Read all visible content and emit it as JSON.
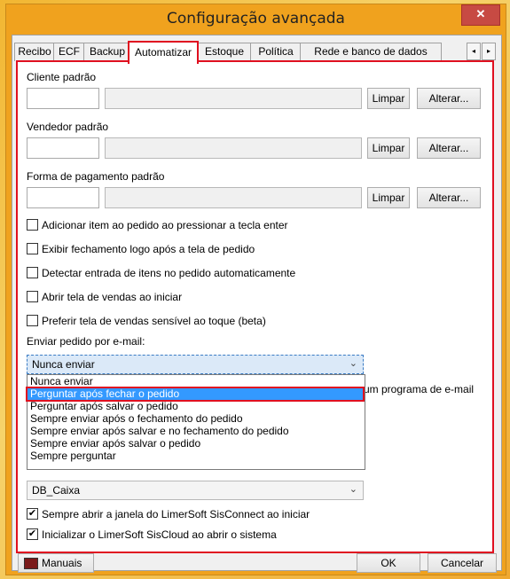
{
  "window": {
    "title": "Configuração avançada",
    "close_label": "✕"
  },
  "tabs": [
    "Recibo",
    "ECF",
    "Backup",
    "Automatizar",
    "Estoque",
    "Política",
    "Rede e banco de dados"
  ],
  "tab_scroll": {
    "left": "◂",
    "right": "▸"
  },
  "fields": {
    "cliente": {
      "label": "Cliente padrão",
      "code": "",
      "name": "",
      "limpar": "Limpar",
      "alterar": "Alterar..."
    },
    "vendedor": {
      "label": "Vendedor padrão",
      "code": "",
      "name": "",
      "limpar": "Limpar",
      "alterar": "Alterar..."
    },
    "pagamento": {
      "label": "Forma de pagamento padrão",
      "code": "",
      "name": "",
      "limpar": "Limpar",
      "alterar": "Alterar..."
    }
  },
  "checkboxes": [
    {
      "label": "Adicionar item ao pedido ao pressionar a tecla enter",
      "checked": false
    },
    {
      "label": "Exibir fechamento logo após a tela de pedido",
      "checked": false
    },
    {
      "label": "Detectar entrada de itens no pedido automaticamente",
      "checked": false
    },
    {
      "label": "Abrir tela de vendas ao iniciar",
      "checked": false
    },
    {
      "label": "Preferir tela de vendas sensível ao toque (beta)",
      "checked": false
    }
  ],
  "email": {
    "label": "Enviar pedido por e-mail:",
    "selected": "Nunca enviar",
    "options": [
      "Nunca enviar",
      "Perguntar após fechar o pedido",
      "Perguntar após salvar o pedido",
      "Sempre enviar após o fechamento do pedido",
      "Sempre enviar após salvar e no fechamento do pedido",
      "Sempre enviar após salvar o pedido",
      "Sempre perguntar"
    ],
    "highlighted_index": 1,
    "partial_text": "um programa de e-mail"
  },
  "db_combo": {
    "value": "DB_Caixa"
  },
  "checkboxes_bottom": [
    {
      "label": "Sempre abrir a janela do LimerSoft SisConnect ao iniciar",
      "checked": true
    },
    {
      "label": "Inicializar o LimerSoft SisCloud ao abrir o sistema",
      "checked": true
    }
  ],
  "footer": {
    "manuais": "Manuais",
    "ok": "OK",
    "cancelar": "Cancelar"
  },
  "colors": {
    "accent_highlight": "#e01020",
    "selection": "#3399ff",
    "titlebar": "#f0a21e",
    "close": "#c74a43"
  }
}
